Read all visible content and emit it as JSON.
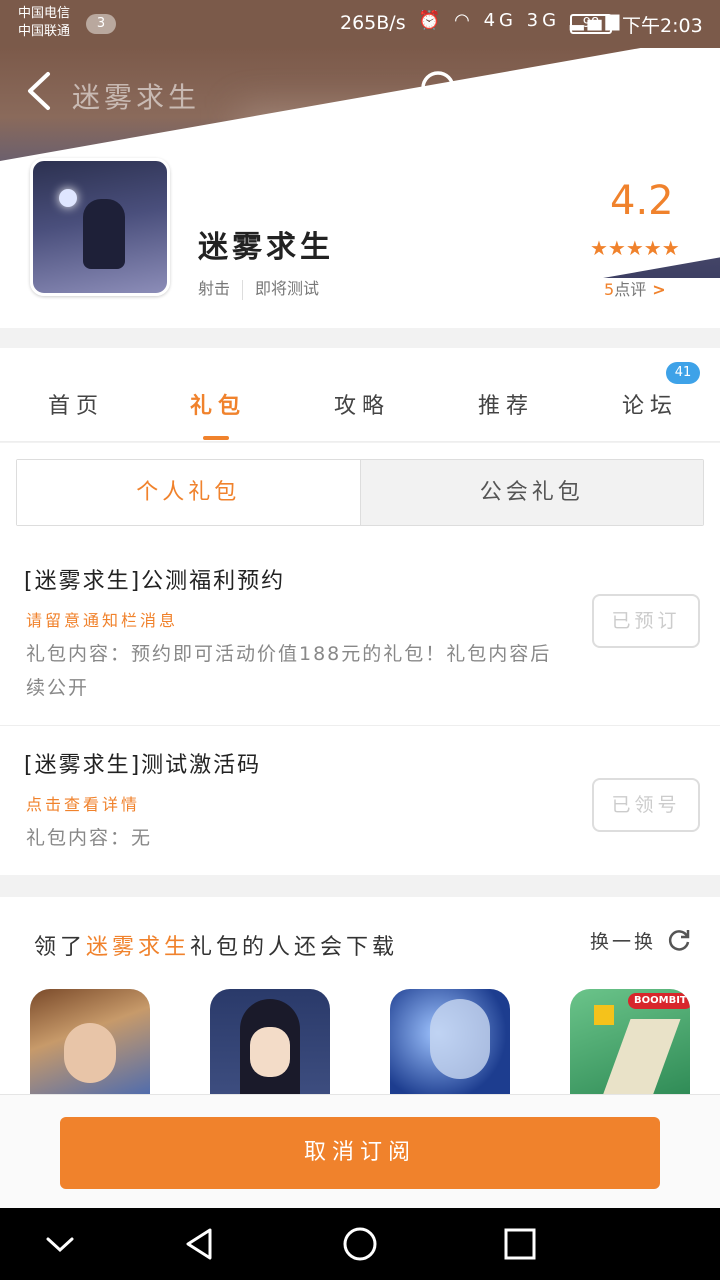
{
  "status_bar": {
    "carrier1": "中国电信",
    "carrier2": "中国联通",
    "notif_count": "3",
    "net_speed": "265B/s",
    "signal_text": "4G 3G",
    "battery": "98",
    "time": "下午2:03"
  },
  "toolbar": {
    "title": "迷雾求生"
  },
  "app": {
    "name": "迷雾求生",
    "tag1": "射击",
    "tag2": "即将测试",
    "rating": "4.2",
    "stars": "★★★★★",
    "review_count": "5",
    "review_suffix": "点评"
  },
  "tabs": {
    "home": "首页",
    "gift": "礼包",
    "guide": "攻略",
    "recommend": "推荐",
    "forum": "论坛",
    "forum_badge": "41"
  },
  "gift_switch": {
    "personal": "个人礼包",
    "guild": "公会礼包"
  },
  "gifts": [
    {
      "title": "[迷雾求生]公测福利预约",
      "subtitle": "请留意通知栏消息",
      "content": "礼包内容：预约即可活动价值188元的礼包！礼包内容后续公开",
      "button": "已预订"
    },
    {
      "title": "[迷雾求生]测试激活码",
      "subtitle": "点击查看详情",
      "content": "礼包内容：无",
      "button": "已领号"
    }
  ],
  "recommend": {
    "prefix": "领了",
    "highlight": "迷雾求生",
    "suffix": "礼包的人还会下载",
    "refresh": "换一换",
    "boombit": "BOOMBIT"
  },
  "bottom": {
    "cancel": "取消订阅"
  },
  "colors": {
    "accent": "#f0822c",
    "badge_blue": "#3ea2e8"
  }
}
